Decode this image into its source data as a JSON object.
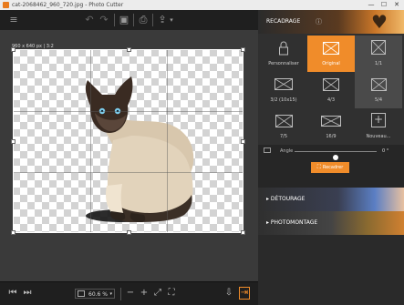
{
  "window": {
    "title": "cat-2068462_960_720.jpg - Photo Cutter",
    "minimize": "—",
    "maximize": "☐",
    "close": "✕"
  },
  "toolbar": {
    "menu_icon": "≡",
    "undo_icon": "↶",
    "redo_icon": "↷",
    "save_icon": "▣",
    "print_icon": "⎙",
    "share_icon": "⇪",
    "share_caret": "▾"
  },
  "canvas": {
    "dimensions": "960 x 640 px | 3:2"
  },
  "bottombar": {
    "prev_icon": "⏮",
    "next_icon": "⏭",
    "zoom_value": "60.6 %",
    "zoom_caret": "▾",
    "zoom_out_icon": "−",
    "zoom_in_icon": "+",
    "fit_icon": "⤢",
    "actual_icon": "⛶",
    "export_icon": "⇩",
    "exit_icon": "⇥"
  },
  "panel": {
    "recadrage": {
      "label": "RECADRAGE",
      "info_icon": "ⓘ",
      "options": [
        {
          "label": "Personnaliser"
        },
        {
          "label": "Original"
        },
        {
          "label": "1/1"
        },
        {
          "label": "3/2 (10x15)"
        },
        {
          "label": "4/3"
        },
        {
          "label": "5/4"
        },
        {
          "label": "7/5"
        },
        {
          "label": "16/9"
        },
        {
          "label": "Nouveau..."
        }
      ],
      "angle_label": "Angle",
      "angle_value": "0 °",
      "angle_level": 0.5,
      "apply_label": "Recadrer"
    },
    "detourage": {
      "label": "DÉTOURAGE"
    },
    "photomontage": {
      "label": "PHOTOMONTAGE"
    }
  },
  "colors": {
    "accent": "#f08c2a",
    "panel_bg": "#262626",
    "toolbar_bg": "#1f1f1f"
  }
}
